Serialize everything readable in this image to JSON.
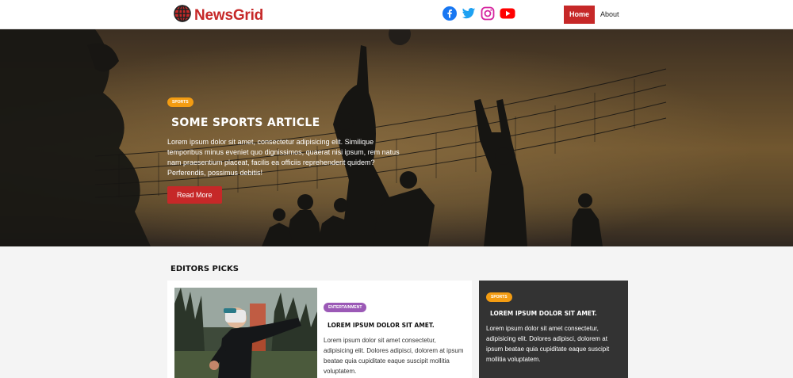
{
  "navbar": {
    "logo_text": "NewsGrid",
    "social": [
      "facebook-icon",
      "twitter-icon",
      "instagram-icon",
      "youtube-icon"
    ],
    "links": [
      "Home",
      "About"
    ]
  },
  "hero": {
    "category": "Sports",
    "title": "Some Sports Article",
    "text": "Lorem ipsum dolor sit amet, consectetur adipisicing elit. Similique temporibus minus eveniet quo dignissimos, quaerat nisi ipsum, rem natus nam praesentium placeat, facilis ea officiis reprehenderit quidem? Perferendis, possimus debitis!",
    "button": "Read More"
  },
  "editors": {
    "title": "Editors Picks",
    "main": {
      "category": "Entertainment",
      "title": "Lorem ipsum dolor sit amet.",
      "text": "Lorem ipsum dolor sit amet consectetur, adipisicing elit. Dolores adipisci, dolorem at ipsum beatae quia cupiditate eaque suscipit mollitia voluptatem."
    },
    "side": {
      "category": "Sports",
      "title": "Lorem ipsum dolor sit amet.",
      "text": "Lorem ipsum dolor sit amet consectetur, adipisicing elit. Dolores adipisci, dolorem at ipsum beatae quia cupiditate eaque suscipit mollitia voluptatem."
    }
  },
  "colors": {
    "brand": "#c62828",
    "sports": "#f39c12",
    "entertainment": "#9b59b6",
    "dark_card": "#333333"
  }
}
